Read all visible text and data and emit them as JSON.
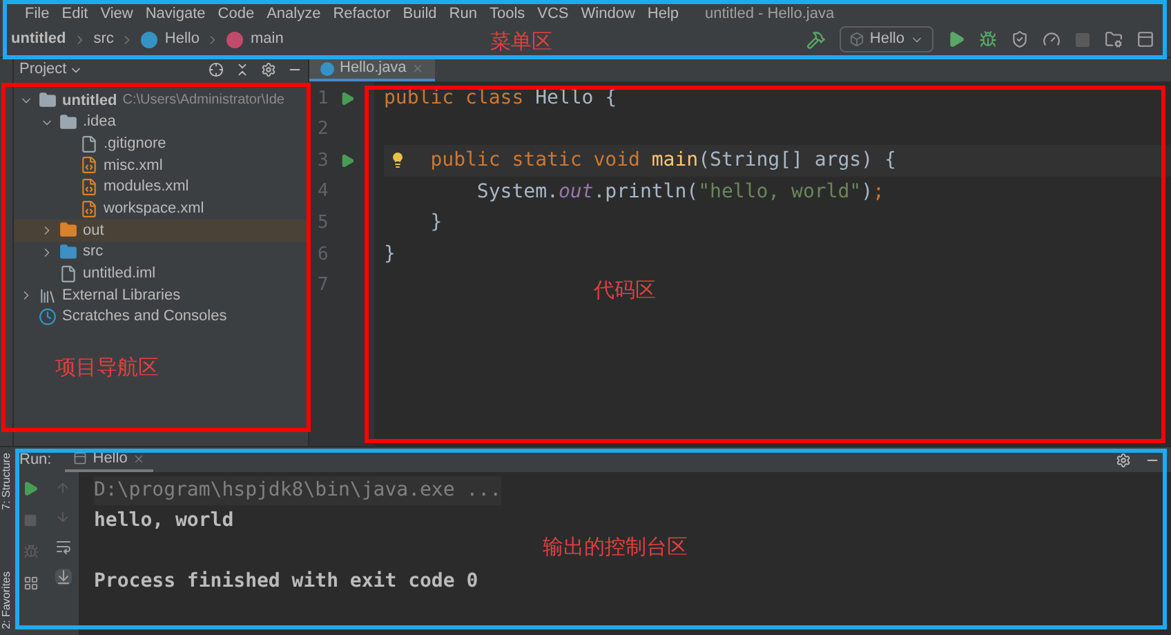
{
  "menu": {
    "items": [
      "File",
      "Edit",
      "View",
      "Navigate",
      "Code",
      "Analyze",
      "Refactor",
      "Build",
      "Run",
      "Tools",
      "VCS",
      "Window",
      "Help"
    ],
    "window_title": "untitled - Hello.java",
    "annotation": {
      "label": "菜单区",
      "color": "#1eaaf1"
    }
  },
  "breadcrumbs": [
    {
      "label": "untitled",
      "kind": "project"
    },
    {
      "label": "src",
      "kind": "folder"
    },
    {
      "label": "Hello",
      "kind": "class"
    },
    {
      "label": "main",
      "kind": "method"
    }
  ],
  "run_config": {
    "label": "Hello"
  },
  "side_labels": [
    "7: Structure",
    "2: Favorites"
  ],
  "project_panel": {
    "title": "Project",
    "annotation": {
      "label": "项目导航区",
      "color": "#ff0000"
    },
    "tree": [
      {
        "label": "untitled",
        "path": "C:\\Users\\Administrator\\Ide",
        "kind": "module",
        "expanded": true,
        "selected": false,
        "children": [
          {
            "label": ".idea",
            "kind": "folder",
            "expanded": true,
            "selected": false,
            "children": [
              {
                "label": ".gitignore",
                "kind": "ignore",
                "selected": false
              },
              {
                "label": "misc.xml",
                "kind": "xml",
                "selected": false
              },
              {
                "label": "modules.xml",
                "kind": "xml",
                "selected": false
              },
              {
                "label": "workspace.xml",
                "kind": "xml",
                "selected": false
              }
            ]
          },
          {
            "label": "out",
            "kind": "out",
            "expanded": false,
            "selected": true
          },
          {
            "label": "src",
            "kind": "source",
            "expanded": false,
            "selected": false
          },
          {
            "label": "untitled.iml",
            "kind": "iml",
            "selected": false
          }
        ]
      },
      {
        "label": "External Libraries",
        "kind": "libraries",
        "expanded": false,
        "selected": false
      },
      {
        "label": "Scratches and Consoles",
        "kind": "scratches",
        "selected": false
      }
    ]
  },
  "editor": {
    "annotation": {
      "label": "代码区",
      "color": "#ff0000"
    },
    "tabs": [
      {
        "label": "Hello.java",
        "selected": true
      }
    ],
    "lines": [
      {
        "number": "1",
        "run": true,
        "current": false,
        "tokens": [
          {
            "kind": "keyword",
            "text": "public class "
          },
          {
            "kind": "plain",
            "text": "Hello {"
          }
        ]
      },
      {
        "number": "2",
        "run": false,
        "current": false
      },
      {
        "number": "3",
        "run": true,
        "current": true,
        "tokens": [
          {
            "kind": "keyword",
            "text": "    public static void "
          },
          {
            "kind": "method",
            "text": "main"
          },
          {
            "kind": "plain",
            "text": "(String[] args) {"
          }
        ]
      },
      {
        "number": "4",
        "run": false,
        "current": false,
        "tokens": [
          {
            "kind": "plain",
            "text": "        System."
          },
          {
            "kind": "field",
            "text": "out"
          },
          {
            "kind": "plain",
            "text": ".println("
          },
          {
            "kind": "string",
            "text": "\"hello, world\""
          },
          {
            "kind": "plain",
            "text": ")"
          },
          {
            "kind": "keyword",
            "text": ";"
          }
        ]
      },
      {
        "number": "5",
        "run": false,
        "current": false,
        "tokens": [
          {
            "kind": "plain",
            "text": "    }"
          }
        ]
      },
      {
        "number": "6",
        "run": false,
        "current": false,
        "tokens": [
          {
            "kind": "plain",
            "text": "}"
          }
        ]
      },
      {
        "number": "7",
        "run": false,
        "current": false
      }
    ]
  },
  "run_panel": {
    "title": "Run:",
    "annotation": {
      "label": "输出的控制台区",
      "color": "#1eaaf1"
    },
    "tabs": [
      {
        "label": "Hello",
        "selected": true
      }
    ],
    "lines": [
      {
        "kind": "command",
        "text": "D:\\program\\hspjdk8\\bin\\java.exe ..."
      },
      {
        "kind": "output",
        "text": "hello, world"
      },
      {
        "kind": "blank"
      },
      {
        "kind": "output",
        "text": "Process finished with exit code 0"
      }
    ]
  }
}
